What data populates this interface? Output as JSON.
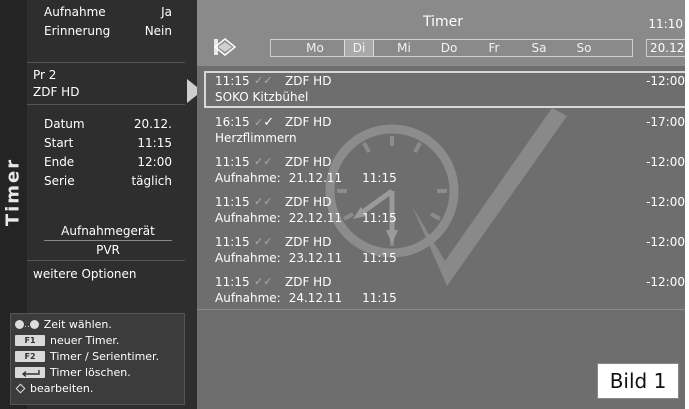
{
  "side_tab": {
    "label": "Timer"
  },
  "left_panel": {
    "top_settings": [
      {
        "label": "Aufnahme",
        "value": "Ja"
      },
      {
        "label": "Erinnerung",
        "value": "Nein"
      }
    ],
    "program": {
      "number": "Pr 2",
      "channel": "ZDF HD"
    },
    "details": [
      {
        "label": "Datum",
        "value": "20.12."
      },
      {
        "label": "Start",
        "value": "11:15"
      },
      {
        "label": "Ende",
        "value": "12:00"
      },
      {
        "label": "Serie",
        "value": "täglich"
      }
    ],
    "recorder_label": "Aufnahmegerät",
    "recorder_value": "PVR",
    "more_options": "weitere Optionen"
  },
  "help": {
    "select_time": "Zeit wählen.",
    "dots_range": "..",
    "f1_key": "F1",
    "f1_text": "neuer Timer.",
    "f2_key": "F2",
    "f2_text": "Timer / Serientimer.",
    "delete_text": "Timer löschen.",
    "edit_text": "bearbeiten."
  },
  "header": {
    "title": "Timer",
    "clock": "11:10",
    "date": "20.12.",
    "weekdays": [
      "Mo",
      "Di",
      "Mi",
      "Do",
      "Fr",
      "Sa",
      "So"
    ],
    "active_weekday": "Di"
  },
  "entries": [
    {
      "start": "11:15",
      "channel": "ZDF HD",
      "end": "-12:00",
      "title": "SOKO Kitzbühel",
      "rec_label": "",
      "rec_date": "",
      "rec_time": "",
      "checked": false
    },
    {
      "start": "16:15",
      "channel": "ZDF HD",
      "end": "-17:00",
      "title": "Herzflimmern",
      "rec_label": "",
      "rec_date": "",
      "rec_time": "",
      "checked": true
    },
    {
      "start": "11:15",
      "channel": "ZDF HD",
      "end": "-12:00",
      "title": "",
      "rec_label": "Aufnahme:",
      "rec_date": "21.12.11",
      "rec_time": "11:15",
      "checked": false
    },
    {
      "start": "11:15",
      "channel": "ZDF HD",
      "end": "-12:00",
      "title": "",
      "rec_label": "Aufnahme:",
      "rec_date": "22.12.11",
      "rec_time": "11:15",
      "checked": false
    },
    {
      "start": "11:15",
      "channel": "ZDF HD",
      "end": "-12:00",
      "title": "",
      "rec_label": "Aufnahme:",
      "rec_date": "23.12.11",
      "rec_time": "11:15",
      "checked": false
    },
    {
      "start": "11:15",
      "channel": "ZDF HD",
      "end": "-12:00",
      "title": "",
      "rec_label": "Aufnahme:",
      "rec_date": "24.12.11",
      "rec_time": "11:15",
      "checked": false
    }
  ],
  "figure_label": "Bild 1"
}
